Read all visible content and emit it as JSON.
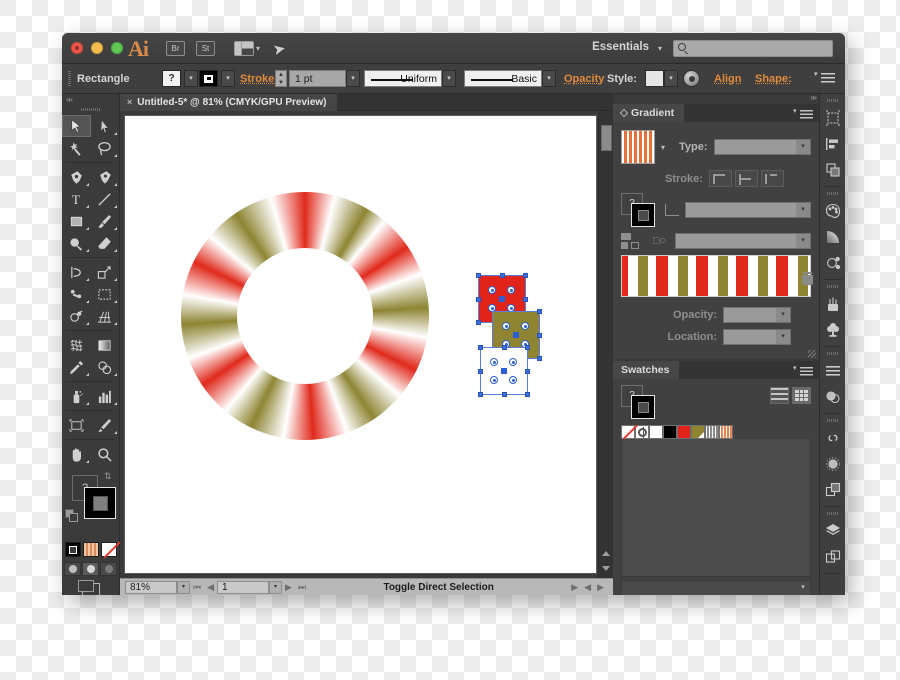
{
  "window": {
    "app_name": "Ai",
    "workspace": "Essentials",
    "search_placeholder": "",
    "titlebar_buttons": [
      "close",
      "minimize",
      "zoom"
    ],
    "bridge_label": "Br",
    "stock_label": "St"
  },
  "control_bar": {
    "tool_label": "Rectangle",
    "fill_value": "?",
    "stroke_label": "Stroke:",
    "stroke_weight": "1 pt",
    "stroke_profile": "Uniform",
    "brush_definition": "Basic",
    "opacity_label": "Opacity",
    "style_label": "Style:",
    "align_label": "Align",
    "shape_label": "Shape:"
  },
  "document": {
    "tab_title": "Untitled-5* @ 81% (CMYK/GPU Preview)",
    "close_glyph": "×"
  },
  "status_bar": {
    "zoom": "81%",
    "page": "1",
    "status_text": "Toggle Direct Selection"
  },
  "tools": {
    "items": [
      {
        "name": "selection-tool",
        "selected": true
      },
      {
        "name": "direct-selection-tool",
        "selected": false
      },
      {
        "name": "magic-wand-tool",
        "selected": false
      },
      {
        "name": "lasso-tool",
        "selected": false
      },
      {
        "name": "pen-tool",
        "selected": false
      },
      {
        "name": "curvature-tool",
        "selected": false
      },
      {
        "name": "type-tool",
        "selected": false
      },
      {
        "name": "line-segment-tool",
        "selected": false
      },
      {
        "name": "rectangle-tool",
        "selected": false
      },
      {
        "name": "paintbrush-tool",
        "selected": false
      },
      {
        "name": "shaper-tool",
        "selected": false
      },
      {
        "name": "eraser-tool",
        "selected": false
      },
      {
        "name": "rotate-tool",
        "selected": false
      },
      {
        "name": "scale-tool",
        "selected": false
      },
      {
        "name": "width-tool",
        "selected": false
      },
      {
        "name": "free-transform-tool",
        "selected": false
      },
      {
        "name": "shape-builder-tool",
        "selected": false
      },
      {
        "name": "perspective-grid-tool",
        "selected": false
      },
      {
        "name": "mesh-tool",
        "selected": false
      },
      {
        "name": "gradient-tool",
        "selected": false
      },
      {
        "name": "eyedropper-tool",
        "selected": false
      },
      {
        "name": "blend-tool",
        "selected": false
      },
      {
        "name": "symbol-sprayer-tool",
        "selected": false
      },
      {
        "name": "column-graph-tool",
        "selected": false
      },
      {
        "name": "artboard-tool",
        "selected": false
      },
      {
        "name": "slice-tool",
        "selected": false
      },
      {
        "name": "hand-tool",
        "selected": false
      },
      {
        "name": "zoom-tool",
        "selected": false
      }
    ],
    "fill_proxy_value": "?",
    "color_modes": [
      "color",
      "gradient",
      "none"
    ],
    "draw_modes": [
      "draw-normal",
      "draw-behind",
      "draw-inside"
    ]
  },
  "gradient_panel": {
    "title": "Gradient",
    "type_label": "Type:",
    "type_value": "",
    "stroke_label": "Stroke:",
    "angle_value": "",
    "aspect_value": "",
    "opacity_label": "Opacity:",
    "opacity_value": "",
    "location_label": "Location:",
    "location_value": "",
    "gradient_colors": [
      "#e02a1c",
      "#ffffff",
      "#8e8432"
    ]
  },
  "swatches_panel": {
    "title": "Swatches",
    "fill_proxy_value": "?",
    "swatches": [
      {
        "name": "none",
        "color": "#ffffff"
      },
      {
        "name": "registration",
        "color": "#ffffff"
      },
      {
        "name": "white",
        "color": "#ffffff"
      },
      {
        "name": "black",
        "color": "#000000"
      },
      {
        "name": "red",
        "color": "#e2231a"
      },
      {
        "name": "olive",
        "color": "#8e8432"
      },
      {
        "name": "gray-gradient",
        "color": "#8d8d8d"
      },
      {
        "name": "orange-gradient",
        "color": "#e8844e"
      }
    ],
    "footer_icons": [
      "swatch-libraries",
      "link-color-harmony",
      "cloud-libraries",
      "show-swatch-kinds",
      "swatch-options",
      "new-color-group",
      "new-swatch",
      "delete-swatch"
    ],
    "view_modes": [
      "list-view",
      "grid-view"
    ]
  },
  "rail": {
    "icons": [
      "artboards-panel",
      "align-panel",
      "pathfinder-panel",
      "color-panel",
      "gradient-panel",
      "color-guide-panel",
      "brushes-panel",
      "symbols-panel",
      "stroke-panel",
      "transparency-panel",
      "creative-cloud-libraries",
      "appearance-panel",
      "graphic-styles-panel",
      "layers-panel",
      "artboards-rail"
    ]
  },
  "artwork": {
    "donut": {
      "name": "gradient-donut-shape",
      "colors": [
        "#e02a1c",
        "#ffffff",
        "#8e8432"
      ],
      "segments": 8
    },
    "dice": [
      {
        "name": "die-red",
        "fill": "#e2231a",
        "pips": 4
      },
      {
        "name": "die-olive",
        "fill": "#8e8432",
        "pips": 4
      },
      {
        "name": "die-white",
        "fill": "#ffffff",
        "pips": 4
      }
    ]
  },
  "colors": {
    "accent_orange": "#e08b3c",
    "panel_bg": "#414141",
    "window_chrome": "#3a3a3a",
    "selection_blue": "#2a5fd6"
  }
}
